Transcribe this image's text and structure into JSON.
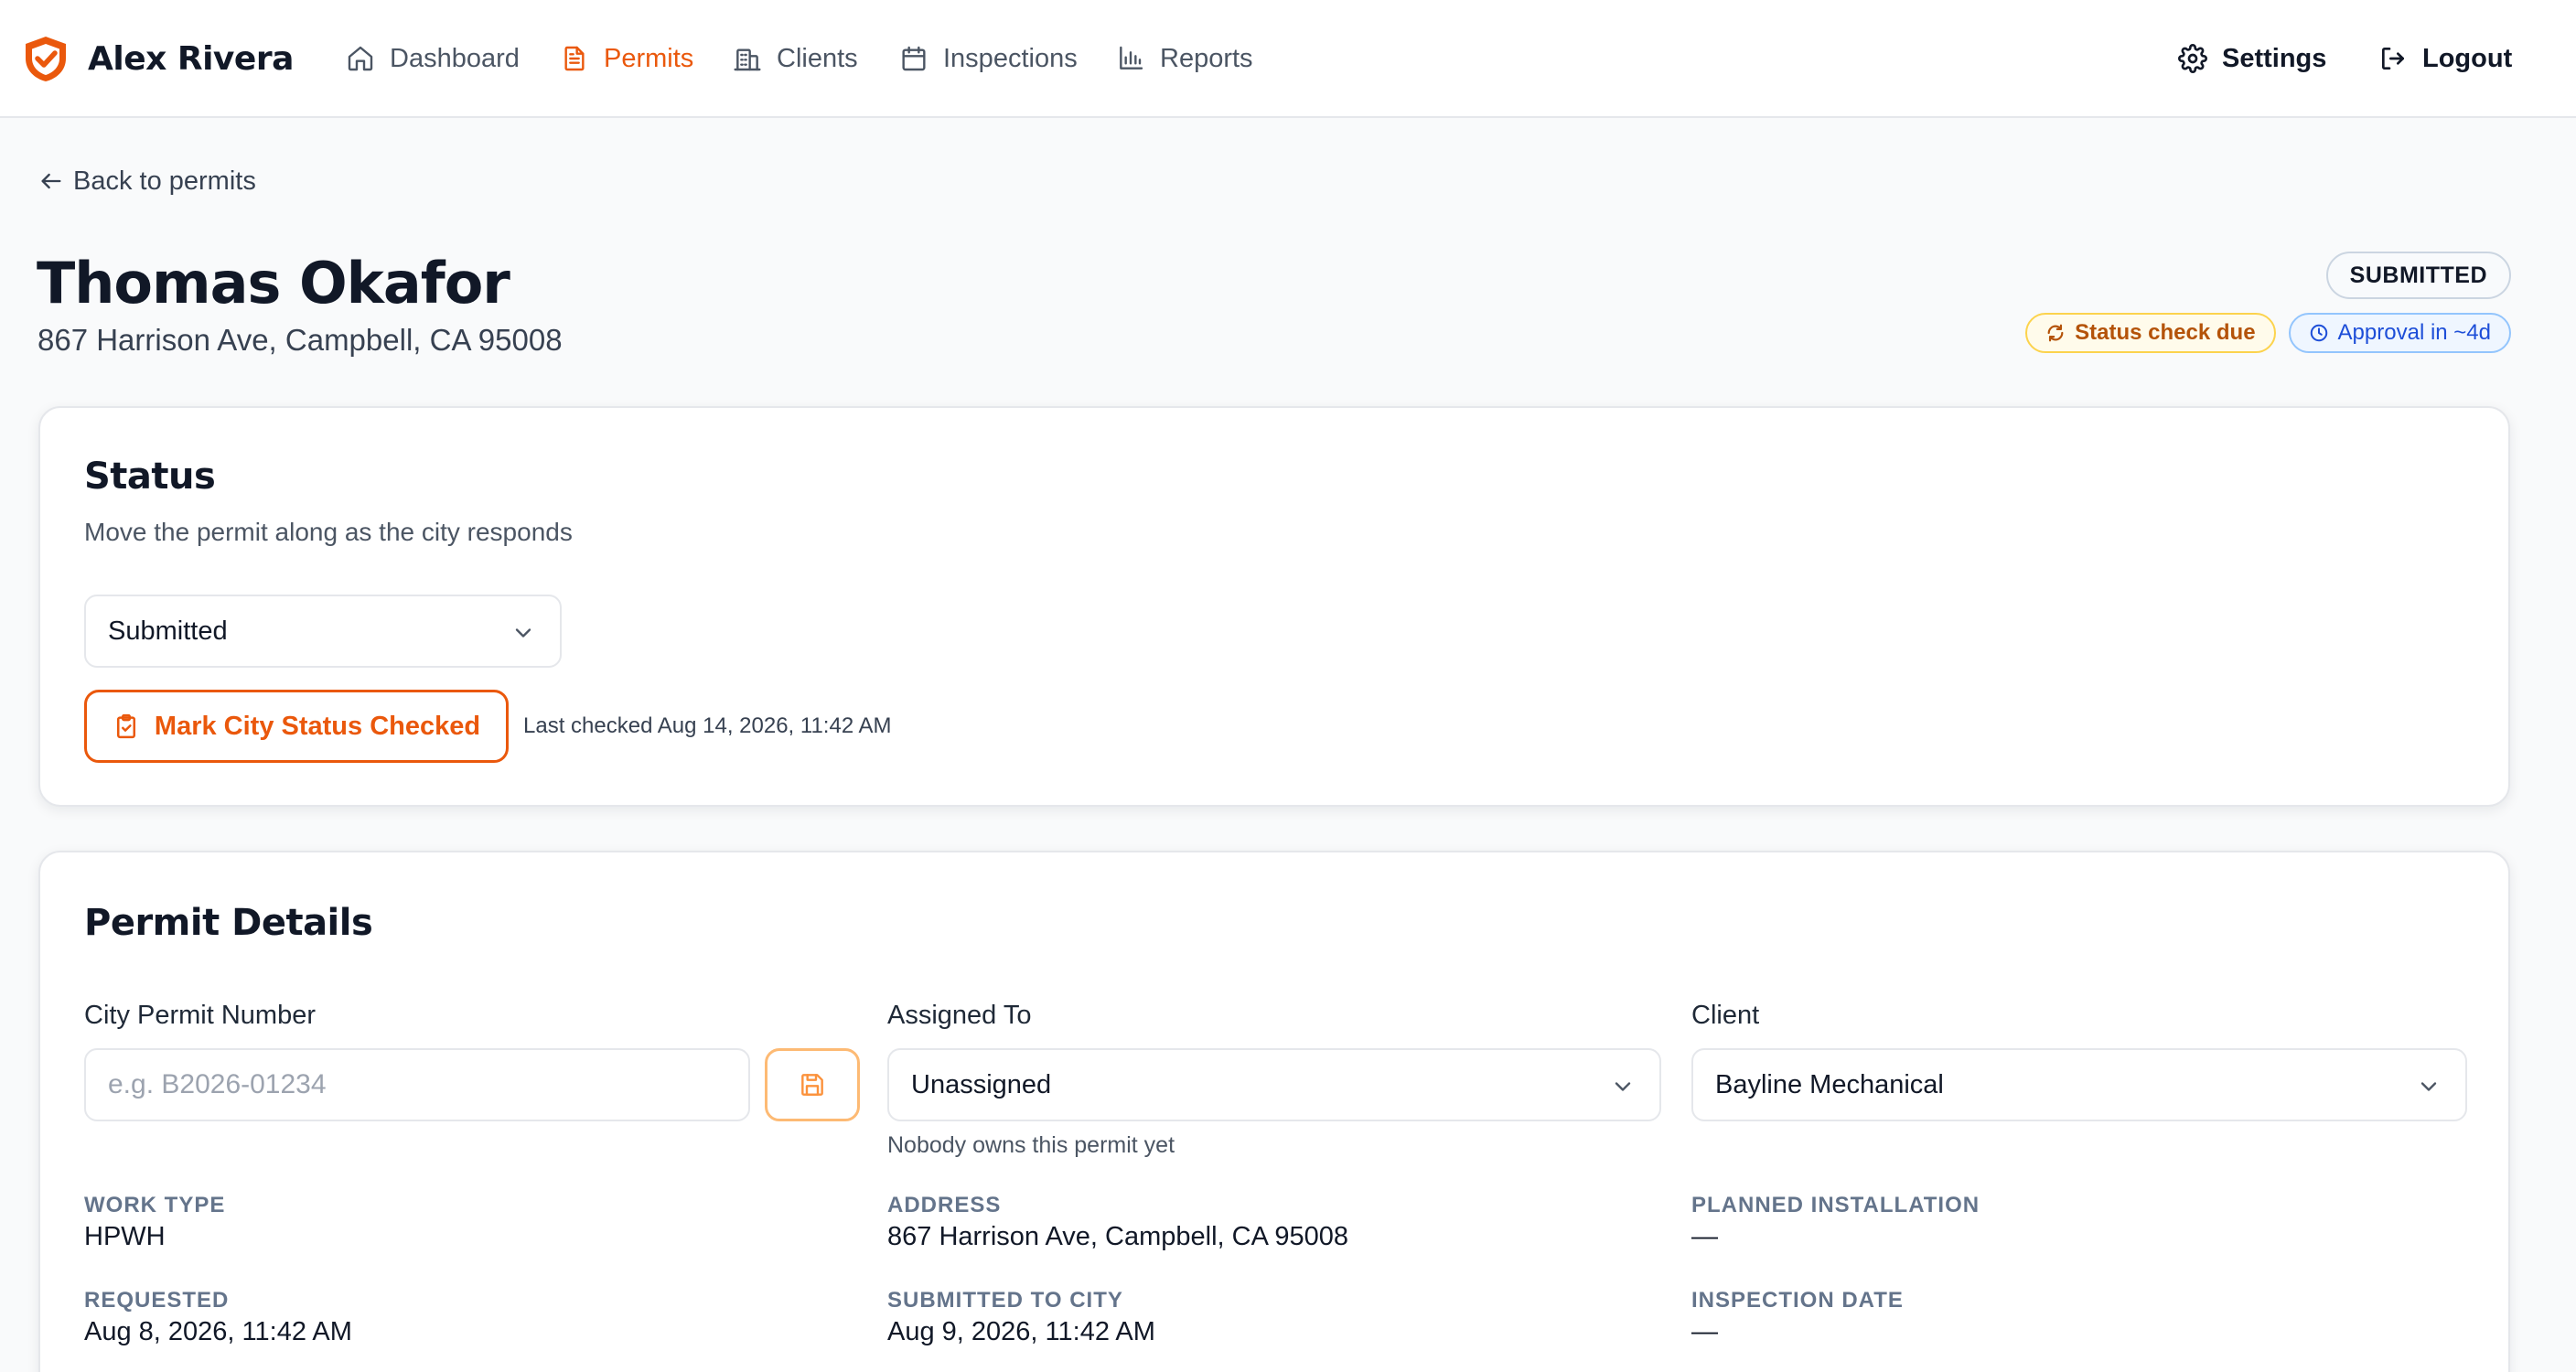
{
  "nav": {
    "brand": "Alex Rivera",
    "items": [
      {
        "label": "Dashboard",
        "icon": "home-icon"
      },
      {
        "label": "Permits",
        "icon": "document-icon",
        "active": true
      },
      {
        "label": "Clients",
        "icon": "building-icon"
      },
      {
        "label": "Inspections",
        "icon": "calendar-icon"
      },
      {
        "label": "Reports",
        "icon": "bar-chart-icon"
      }
    ],
    "settings": "Settings",
    "logout": "Logout"
  },
  "header": {
    "back": "Back to permits",
    "title": "Thomas Okafor",
    "address": "867 Harrison Ave, Campbell, CA 95008",
    "status_badge": "SUBMITTED",
    "status_check": "Status check due",
    "approval": "Approval in ~4d"
  },
  "status_card": {
    "title": "Status",
    "description": "Move the permit along as the city responds",
    "selected_status": "Submitted",
    "button": "Mark City Status Checked",
    "last_checked": "Last checked Aug 14, 2026, 11:42 AM"
  },
  "details": {
    "title": "Permit Details",
    "city_permit_label": "City Permit Number",
    "city_permit_placeholder": "e.g. B2026-01234",
    "assigned_label": "Assigned To",
    "assigned_value": "Unassigned",
    "assigned_helper": "Nobody owns this permit yet",
    "client_label": "Client",
    "client_value": "Bayline Mechanical",
    "fields": [
      {
        "label": "WORK TYPE",
        "value": "HPWH"
      },
      {
        "label": "ADDRESS",
        "value": "867 Harrison Ave, Campbell, CA 95008"
      },
      {
        "label": "PLANNED INSTALLATION",
        "value": "—"
      },
      {
        "label": "REQUESTED",
        "value": "Aug 8, 2026, 11:42 AM"
      },
      {
        "label": "SUBMITTED TO CITY",
        "value": "Aug 9, 2026, 11:42 AM"
      },
      {
        "label": "INSPECTION DATE",
        "value": "—"
      }
    ]
  },
  "colors": {
    "accent": "#ea580c",
    "warning": "#b45309",
    "info": "#1d4ed8"
  }
}
